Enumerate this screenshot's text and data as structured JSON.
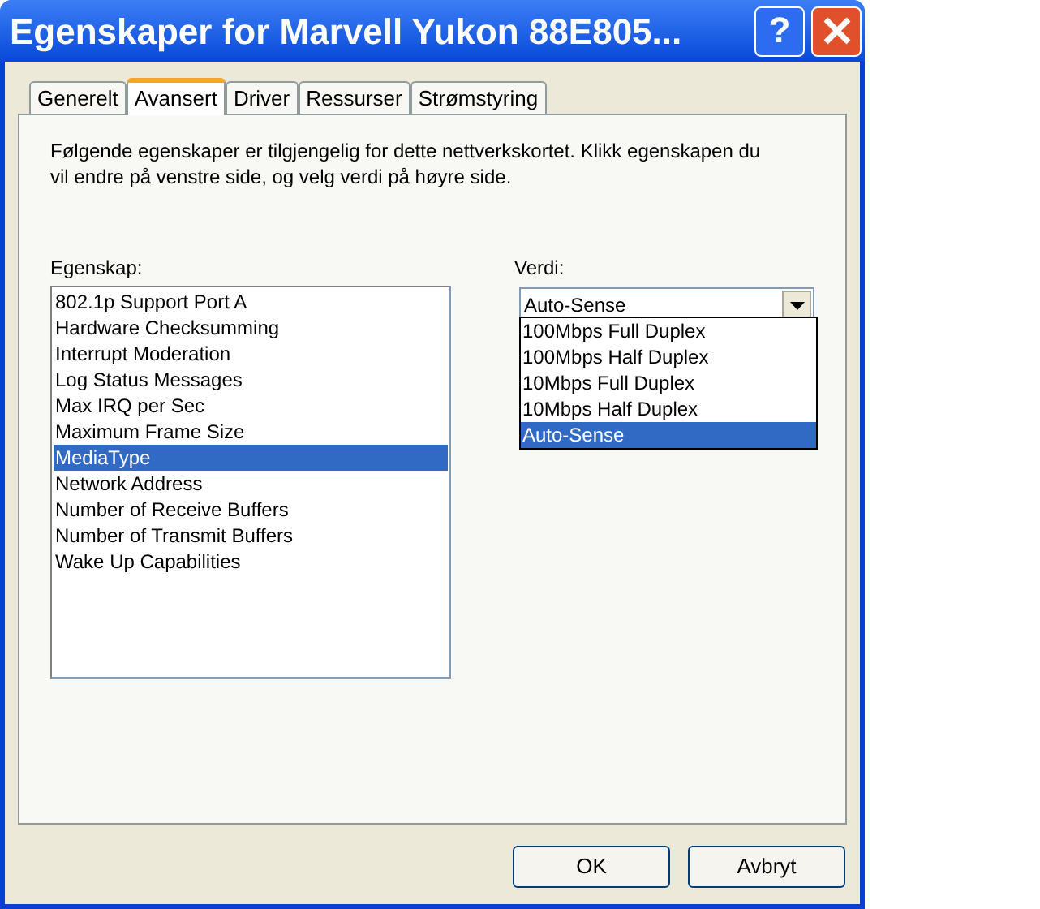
{
  "window": {
    "title": "Egenskaper for Marvell Yukon 88E805...",
    "help_button": "?"
  },
  "tabs": [
    {
      "label": "Generelt",
      "selected": false
    },
    {
      "label": "Avansert",
      "selected": true
    },
    {
      "label": "Driver",
      "selected": false
    },
    {
      "label": "Ressurser",
      "selected": false
    },
    {
      "label": "Strømstyring",
      "selected": false
    }
  ],
  "description": "Følgende egenskaper er tilgjengelig for dette nettverkskortet. Klikk egenskapen du vil endre på venstre side, og velg verdi på høyre side.",
  "property_list": {
    "label": "Egenskap:",
    "items": [
      {
        "label": "802.1p Support Port A",
        "selected": false
      },
      {
        "label": "Hardware Checksumming",
        "selected": false
      },
      {
        "label": "Interrupt Moderation",
        "selected": false
      },
      {
        "label": "Log Status Messages",
        "selected": false
      },
      {
        "label": "Max IRQ per Sec",
        "selected": false
      },
      {
        "label": "Maximum Frame Size",
        "selected": false
      },
      {
        "label": "MediaType",
        "selected": true
      },
      {
        "label": "Network Address",
        "selected": false
      },
      {
        "label": "Number of Receive Buffers",
        "selected": false
      },
      {
        "label": "Number of Transmit Buffers",
        "selected": false
      },
      {
        "label": "Wake Up Capabilities",
        "selected": false
      }
    ]
  },
  "value": {
    "label": "Verdi:",
    "value": "Auto-Sense",
    "expanded": true,
    "options": [
      {
        "label": "100Mbps Full Duplex",
        "selected": false
      },
      {
        "label": "100Mbps Half Duplex",
        "selected": false
      },
      {
        "label": "10Mbps Full Duplex",
        "selected": false
      },
      {
        "label": "10Mbps Half Duplex",
        "selected": false
      },
      {
        "label": "Auto-Sense",
        "selected": true
      }
    ]
  },
  "buttons": [
    "OK",
    "Avbryt"
  ]
}
